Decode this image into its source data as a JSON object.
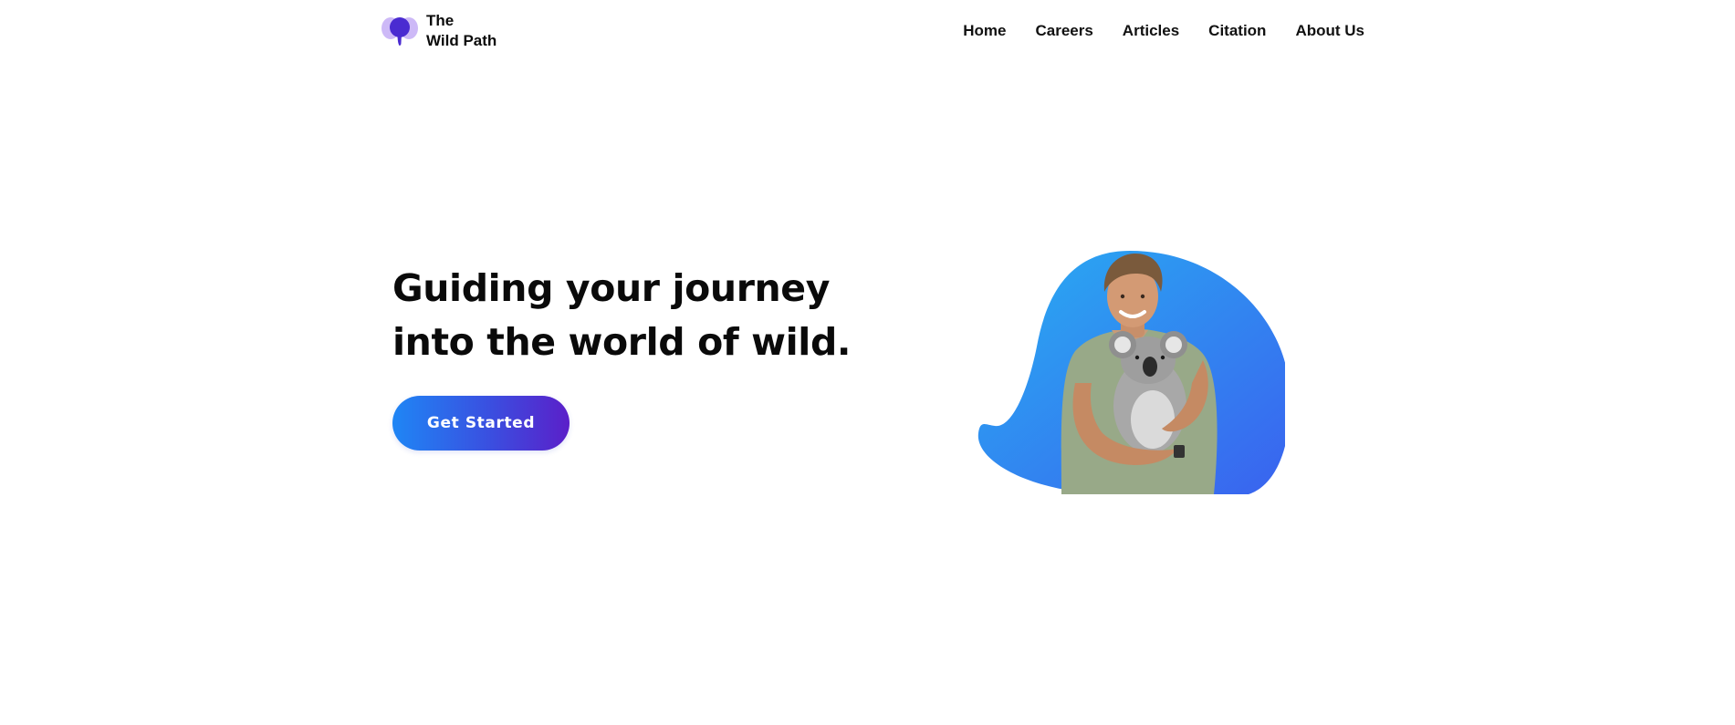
{
  "brand": {
    "line1": "The",
    "line2": "Wild Path",
    "logo_icon": "elephant-icon",
    "logo_color": "#4a2bd1",
    "logo_ears_color": "#c9b5f5"
  },
  "nav": {
    "items": [
      {
        "label": "Home"
      },
      {
        "label": "Careers"
      },
      {
        "label": "Articles"
      },
      {
        "label": "Citation"
      },
      {
        "label": "About Us"
      }
    ]
  },
  "hero": {
    "title_line1": "Guiding your journey",
    "title_line2": "into the world of wild.",
    "cta_label": "Get Started",
    "image_subject": "man-holding-koala",
    "blob_colors": [
      "#27a7f0",
      "#3a67ef"
    ]
  }
}
